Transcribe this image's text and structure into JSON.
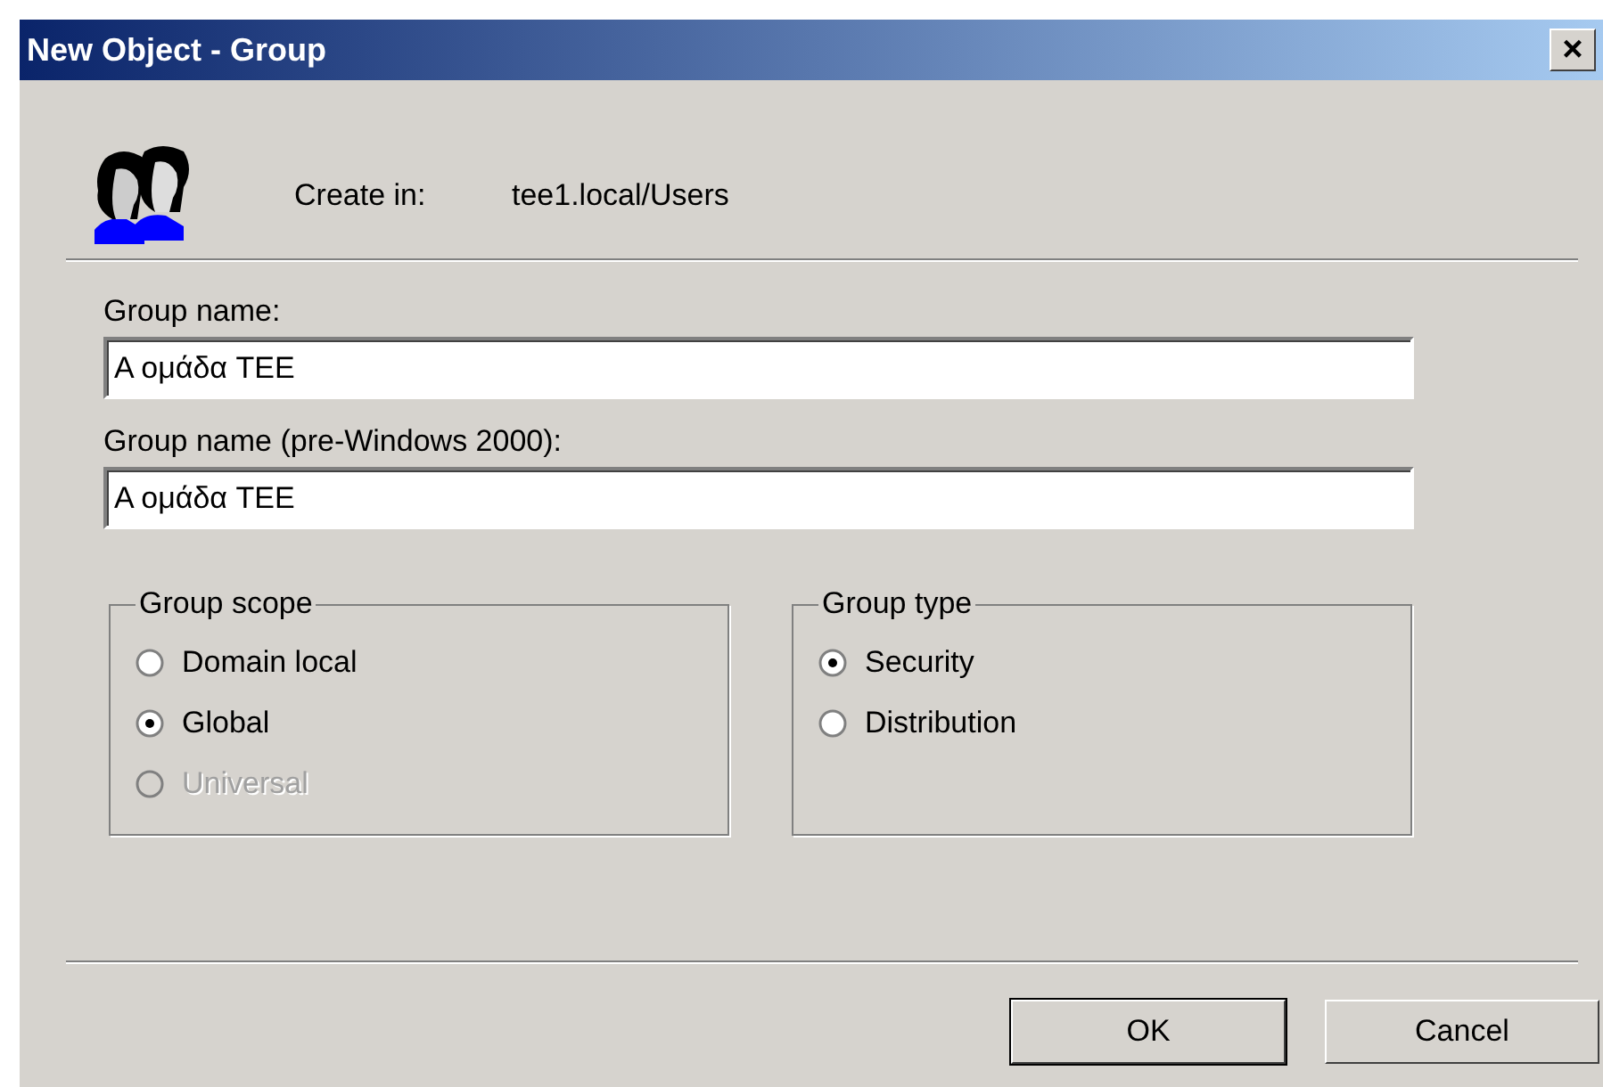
{
  "window": {
    "title": "New Object - Group",
    "close": "×"
  },
  "header": {
    "label": "Create in:",
    "path": "tee1.local/Users"
  },
  "fields": [
    {
      "label": "Group name:",
      "value": "Α ομάδα TEE"
    },
    {
      "label": "Group name (pre-Windows 2000):",
      "value": "Α ομάδα TEE"
    }
  ],
  "groups": [
    {
      "title": "Group scope",
      "options": [
        {
          "label": "Domain local",
          "selected": false,
          "disabled": false
        },
        {
          "label": "Global",
          "selected": true,
          "disabled": false
        },
        {
          "label": "Universal",
          "selected": false,
          "disabled": true
        }
      ]
    },
    {
      "title": "Group type",
      "options": [
        {
          "label": "Security",
          "selected": true,
          "disabled": false
        },
        {
          "label": "Distribution",
          "selected": false,
          "disabled": false
        }
      ]
    }
  ],
  "buttons": [
    {
      "label": "OK",
      "default": true
    },
    {
      "label": "Cancel",
      "default": false
    }
  ]
}
